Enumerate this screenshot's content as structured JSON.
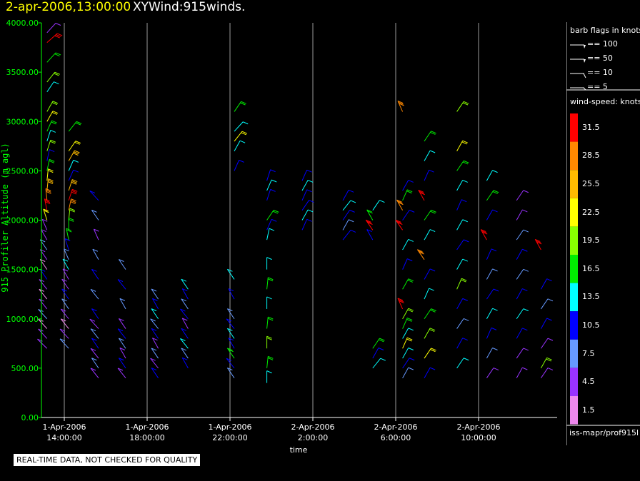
{
  "header": {
    "datetime": "2-apr-2006,13:00:00",
    "product": "XYWind:915winds."
  },
  "footer": {
    "note": "REAL-TIME DATA, NOT CHECKED FOR QUALITY",
    "source": "iss-mapr/prof915l"
  },
  "legend": {
    "barb_title": "barb flags in knots",
    "barb_items": [
      {
        "label": "== 100",
        "knots": 100
      },
      {
        "label": "== 50",
        "knots": 50
      },
      {
        "label": "== 10",
        "knots": 10
      },
      {
        "label": "== 5",
        "knots": 5
      }
    ],
    "speed_title": "wind-speed: knots",
    "speed_bins": [
      {
        "label": "31.5",
        "color": "#ff0000"
      },
      {
        "label": "28.5",
        "color": "#ff8800"
      },
      {
        "label": "25.5",
        "color": "#ffbb00"
      },
      {
        "label": "22.5",
        "color": "#ffff00"
      },
      {
        "label": "19.5",
        "color": "#88ff00"
      },
      {
        "label": "16.5",
        "color": "#00ee00"
      },
      {
        "label": "13.5",
        "color": "#00ffff"
      },
      {
        "label": "10.5",
        "color": "#0000ff"
      },
      {
        "label": "7.5",
        "color": "#6699ff"
      },
      {
        "label": "4.5",
        "color": "#9933ff"
      },
      {
        "label": "1.5",
        "color": "#ee88ee"
      }
    ]
  },
  "chart_data": {
    "type": "wind-barb time-height",
    "ylabel": "915 Profiler Altitude (m agl)",
    "xlabel": "time",
    "ylim": [
      0,
      4000
    ],
    "yticks": [
      "4000.00",
      "3500.00",
      "3000.00",
      "2500.00",
      "2000.00",
      "1500.00",
      "1000.00",
      "500.00",
      "0.00"
    ],
    "xticks": [
      {
        "date": "1-Apr-2006",
        "time": "14:00:00"
      },
      {
        "date": "1-Apr-2006",
        "time": "18:00:00"
      },
      {
        "date": "1-Apr-2006",
        "time": "22:00:00"
      },
      {
        "date": "2-Apr-2006",
        "time": "2:00:00"
      },
      {
        "date": "2-Apr-2006",
        "time": "6:00:00"
      },
      {
        "date": "2-Apr-2006",
        "time": "10:00:00"
      }
    ],
    "time_range_hours": [
      12.9,
      13.0
    ],
    "vertical_gridlines": true,
    "colors": {
      "axis": "#00ff00",
      "grid": "#9a9a9a",
      "ylabel": "#00ff00",
      "xlabel": "#ffffff"
    },
    "profiles": [
      {
        "t": 0.1,
        "alt": [
          [
            3900,
            0.8,
            3.9
          ],
          [
            3800,
            1.0,
            31.5
          ],
          [
            3600,
            0.8,
            16.5
          ],
          [
            3400,
            0.7,
            19.5
          ],
          [
            3300,
            0.6,
            13.5
          ],
          [
            3100,
            0.5,
            19.5
          ],
          [
            3000,
            0.5,
            22.5
          ],
          [
            2900,
            0.4,
            16.5
          ],
          [
            2800,
            0.3,
            13.5
          ],
          [
            2700,
            0.3,
            19.5
          ],
          [
            2600,
            0.2,
            10.5
          ],
          [
            2500,
            0.2,
            16.5
          ],
          [
            2400,
            0.1,
            22.5
          ],
          [
            2300,
            0.1,
            25.5
          ],
          [
            2200,
            -0.1,
            28.5
          ],
          [
            2100,
            -0.2,
            31.5
          ],
          [
            2000,
            -0.3,
            22.5
          ],
          [
            1900,
            -0.4,
            4.5
          ],
          [
            1800,
            -0.5,
            4.5
          ],
          [
            1700,
            -0.6,
            7.5
          ],
          [
            1600,
            -0.6,
            4.5
          ],
          [
            1500,
            -0.6,
            1.5
          ],
          [
            1400,
            -0.6,
            10.5
          ],
          [
            1300,
            -0.7,
            4.5
          ],
          [
            1200,
            -0.7,
            1.5
          ],
          [
            1100,
            -0.7,
            4.5
          ],
          [
            1000,
            -0.8,
            7.5
          ],
          [
            900,
            -0.8,
            1.5
          ],
          [
            800,
            -0.8,
            4.5
          ],
          [
            700,
            -0.9,
            4.5
          ]
        ]
      },
      {
        "t": 0.9,
        "alt": [
          [
            2900,
            0.7,
            16.5
          ],
          [
            2700,
            0.6,
            22.5
          ],
          [
            2600,
            0.5,
            25.5
          ],
          [
            2500,
            0.4,
            13.5
          ],
          [
            2400,
            0.4,
            10.5
          ],
          [
            2300,
            0.3,
            25.5
          ],
          [
            2200,
            0.3,
            31.5
          ],
          [
            2100,
            0.2,
            28.5
          ],
          [
            2000,
            0.1,
            19.5
          ],
          [
            1900,
            0.0,
            16.5
          ],
          [
            1800,
            -0.2,
            16.5
          ],
          [
            1700,
            -0.3,
            10.5
          ],
          [
            1600,
            -0.4,
            7.5
          ],
          [
            1500,
            -0.5,
            13.5
          ],
          [
            1400,
            -0.5,
            4.5
          ],
          [
            1300,
            -0.6,
            4.5
          ],
          [
            1200,
            -0.6,
            10.5
          ],
          [
            1100,
            -0.6,
            7.5
          ],
          [
            1000,
            -0.7,
            4.5
          ],
          [
            900,
            -0.7,
            1.5
          ],
          [
            800,
            -0.8,
            4.5
          ],
          [
            700,
            -0.8,
            7.5
          ]
        ]
      },
      {
        "t": 2.0,
        "alt": [
          [
            2200,
            -0.8,
            10.5
          ],
          [
            2000,
            -0.6,
            7.5
          ],
          [
            1800,
            -0.4,
            4.5
          ],
          [
            1600,
            -0.5,
            7.5
          ],
          [
            1400,
            -0.6,
            10.5
          ],
          [
            1200,
            -0.7,
            7.5
          ],
          [
            1000,
            -0.6,
            10.5
          ],
          [
            900,
            -0.8,
            4.5
          ],
          [
            800,
            -0.7,
            7.5
          ],
          [
            700,
            -0.6,
            10.5
          ],
          [
            600,
            -0.7,
            4.5
          ],
          [
            500,
            -0.6,
            7.5
          ],
          [
            400,
            -0.7,
            4.5
          ]
        ]
      },
      {
        "t": 3.0,
        "alt": [
          [
            1500,
            -0.6,
            7.5
          ],
          [
            1300,
            -0.7,
            10.5
          ],
          [
            1100,
            -0.5,
            7.5
          ],
          [
            900,
            -0.6,
            4.5
          ],
          [
            800,
            -0.7,
            10.5
          ],
          [
            700,
            -0.6,
            7.5
          ],
          [
            600,
            -0.5,
            4.5
          ],
          [
            500,
            -0.6,
            10.5
          ],
          [
            400,
            -0.7,
            4.5
          ]
        ]
      },
      {
        "t": 4.2,
        "alt": [
          [
            1200,
            -0.6,
            7.5
          ],
          [
            1100,
            -0.5,
            10.5
          ],
          [
            1000,
            -0.6,
            13.5
          ],
          [
            900,
            -0.7,
            7.5
          ],
          [
            800,
            -0.6,
            10.5
          ],
          [
            700,
            -0.5,
            4.5
          ],
          [
            600,
            -0.6,
            7.5
          ],
          [
            500,
            -0.7,
            4.5
          ],
          [
            400,
            -0.6,
            10.5
          ]
        ]
      },
      {
        "t": 5.3,
        "alt": [
          [
            1300,
            -0.6,
            13.5
          ],
          [
            1200,
            -0.5,
            10.5
          ],
          [
            1100,
            -0.6,
            7.5
          ],
          [
            1000,
            -0.7,
            10.5
          ],
          [
            900,
            -0.5,
            4.5
          ],
          [
            800,
            -0.6,
            10.5
          ],
          [
            700,
            -0.7,
            13.5
          ],
          [
            600,
            -0.6,
            7.5
          ],
          [
            500,
            -0.5,
            10.5
          ]
        ]
      },
      {
        "t": 7.0,
        "alt": [
          [
            3100,
            0.6,
            16.5
          ],
          [
            2900,
            0.8,
            13.5
          ],
          [
            2800,
            0.7,
            22.5
          ],
          [
            2700,
            0.5,
            13.5
          ],
          [
            2500,
            0.4,
            10.5
          ],
          [
            1400,
            -0.6,
            13.5
          ],
          [
            1200,
            -0.5,
            10.5
          ],
          [
            1000,
            -0.6,
            7.5
          ],
          [
            900,
            -0.7,
            10.5
          ],
          [
            800,
            -0.6,
            13.5
          ],
          [
            700,
            -0.5,
            10.5
          ],
          [
            600,
            -0.6,
            16.5
          ],
          [
            500,
            -0.7,
            10.5
          ],
          [
            400,
            -0.6,
            7.5
          ]
        ]
      },
      {
        "t": 8.2,
        "alt": [
          [
            2400,
            0.3,
            10.5
          ],
          [
            2300,
            0.4,
            13.5
          ],
          [
            2200,
            0.3,
            10.5
          ],
          [
            2000,
            0.6,
            16.5
          ],
          [
            1900,
            0.4,
            10.5
          ],
          [
            1800,
            0.2,
            13.5
          ],
          [
            1500,
            0.0,
            13.5
          ],
          [
            1300,
            0.1,
            16.5
          ],
          [
            1100,
            0.0,
            13.5
          ],
          [
            900,
            0.1,
            16.5
          ],
          [
            700,
            0.0,
            19.5
          ],
          [
            500,
            0.1,
            16.5
          ],
          [
            350,
            0.0,
            13.5
          ]
        ]
      },
      {
        "t": 9.5,
        "alt": [
          [
            2400,
            0.4,
            10.5
          ],
          [
            2300,
            0.5,
            13.5
          ],
          [
            2200,
            0.4,
            10.5
          ],
          [
            2100,
            0.6,
            10.5
          ],
          [
            2000,
            0.5,
            13.5
          ],
          [
            1900,
            0.4,
            10.5
          ]
        ]
      },
      {
        "t": 11.0,
        "alt": [
          [
            2200,
            0.5,
            10.5
          ],
          [
            2100,
            0.7,
            13.5
          ],
          [
            2000,
            0.6,
            10.5
          ],
          [
            1900,
            0.5,
            7.5
          ],
          [
            1800,
            0.7,
            10.5
          ]
        ]
      },
      {
        "t": 12.1,
        "alt": [
          [
            2100,
            0.6,
            13.5
          ],
          [
            2000,
            -0.5,
            16.5
          ],
          [
            1900,
            -0.6,
            31.5
          ],
          [
            1800,
            -0.5,
            10.5
          ],
          [
            700,
            0.6,
            16.5
          ],
          [
            600,
            0.5,
            10.5
          ],
          [
            500,
            0.7,
            13.5
          ]
        ]
      },
      {
        "t": 13.2,
        "alt": [
          [
            3100,
            -0.4,
            28.5
          ],
          [
            2300,
            0.5,
            10.5
          ],
          [
            2200,
            0.4,
            16.5
          ],
          [
            2100,
            -0.5,
            28.5
          ],
          [
            2000,
            0.6,
            10.5
          ],
          [
            1900,
            -0.6,
            31.5
          ],
          [
            1700,
            0.5,
            13.5
          ],
          [
            1500,
            0.4,
            10.5
          ],
          [
            1300,
            0.5,
            16.5
          ],
          [
            1100,
            -0.4,
            31.5
          ],
          [
            1000,
            0.5,
            19.5
          ],
          [
            900,
            0.4,
            16.5
          ],
          [
            800,
            0.5,
            13.5
          ],
          [
            700,
            0.4,
            22.5
          ],
          [
            600,
            0.5,
            13.5
          ],
          [
            500,
            0.6,
            10.5
          ],
          [
            400,
            0.5,
            7.5
          ]
        ]
      },
      {
        "t": 14.0,
        "alt": [
          [
            2800,
            0.6,
            16.5
          ],
          [
            2600,
            0.5,
            13.5
          ],
          [
            2400,
            0.4,
            10.5
          ],
          [
            2200,
            -0.5,
            31.5
          ],
          [
            2000,
            0.6,
            16.5
          ],
          [
            1800,
            0.5,
            13.5
          ],
          [
            1600,
            -0.6,
            28.5
          ],
          [
            1400,
            0.5,
            10.5
          ],
          [
            1200,
            0.4,
            13.5
          ],
          [
            1000,
            0.6,
            16.5
          ],
          [
            800,
            0.5,
            19.5
          ],
          [
            600,
            0.6,
            22.5
          ],
          [
            400,
            0.5,
            10.5
          ]
        ]
      },
      {
        "t": 15.2,
        "alt": [
          [
            3100,
            0.6,
            19.5
          ],
          [
            2700,
            0.5,
            22.5
          ],
          [
            2500,
            0.6,
            16.5
          ],
          [
            2300,
            0.5,
            13.5
          ],
          [
            2100,
            0.4,
            10.5
          ],
          [
            1900,
            0.5,
            13.5
          ],
          [
            1700,
            0.6,
            10.5
          ],
          [
            1500,
            0.5,
            13.5
          ],
          [
            1300,
            0.4,
            19.5
          ],
          [
            1100,
            0.5,
            10.5
          ],
          [
            900,
            0.6,
            7.5
          ],
          [
            700,
            0.5,
            10.5
          ],
          [
            500,
            0.6,
            13.5
          ]
        ]
      },
      {
        "t": 16.3,
        "alt": [
          [
            2400,
            0.5,
            13.5
          ],
          [
            2200,
            0.6,
            16.5
          ],
          [
            2000,
            0.5,
            10.5
          ],
          [
            1800,
            -0.5,
            31.5
          ],
          [
            1600,
            0.4,
            10.5
          ],
          [
            1400,
            0.5,
            7.5
          ],
          [
            1200,
            0.6,
            10.5
          ],
          [
            1000,
            0.5,
            13.5
          ],
          [
            800,
            0.4,
            10.5
          ],
          [
            600,
            0.5,
            7.5
          ],
          [
            400,
            0.6,
            4.5
          ]
        ]
      },
      {
        "t": 17.4,
        "alt": [
          [
            2200,
            0.6,
            4.5
          ],
          [
            2000,
            0.5,
            4.5
          ],
          [
            1800,
            0.6,
            7.5
          ],
          [
            1600,
            0.5,
            10.5
          ],
          [
            1400,
            0.6,
            7.5
          ],
          [
            1200,
            0.5,
            10.5
          ],
          [
            1000,
            0.6,
            13.5
          ],
          [
            800,
            0.5,
            10.5
          ],
          [
            600,
            0.6,
            4.5
          ],
          [
            400,
            0.5,
            4.5
          ]
        ]
      },
      {
        "t": 18.3,
        "alt": [
          [
            1700,
            -0.5,
            31.5
          ],
          [
            1300,
            0.5,
            10.5
          ],
          [
            1100,
            0.6,
            7.5
          ],
          [
            900,
            0.5,
            10.5
          ],
          [
            700,
            0.6,
            4.5
          ],
          [
            500,
            0.5,
            19.5
          ],
          [
            400,
            0.6,
            4.5
          ]
        ]
      }
    ]
  }
}
